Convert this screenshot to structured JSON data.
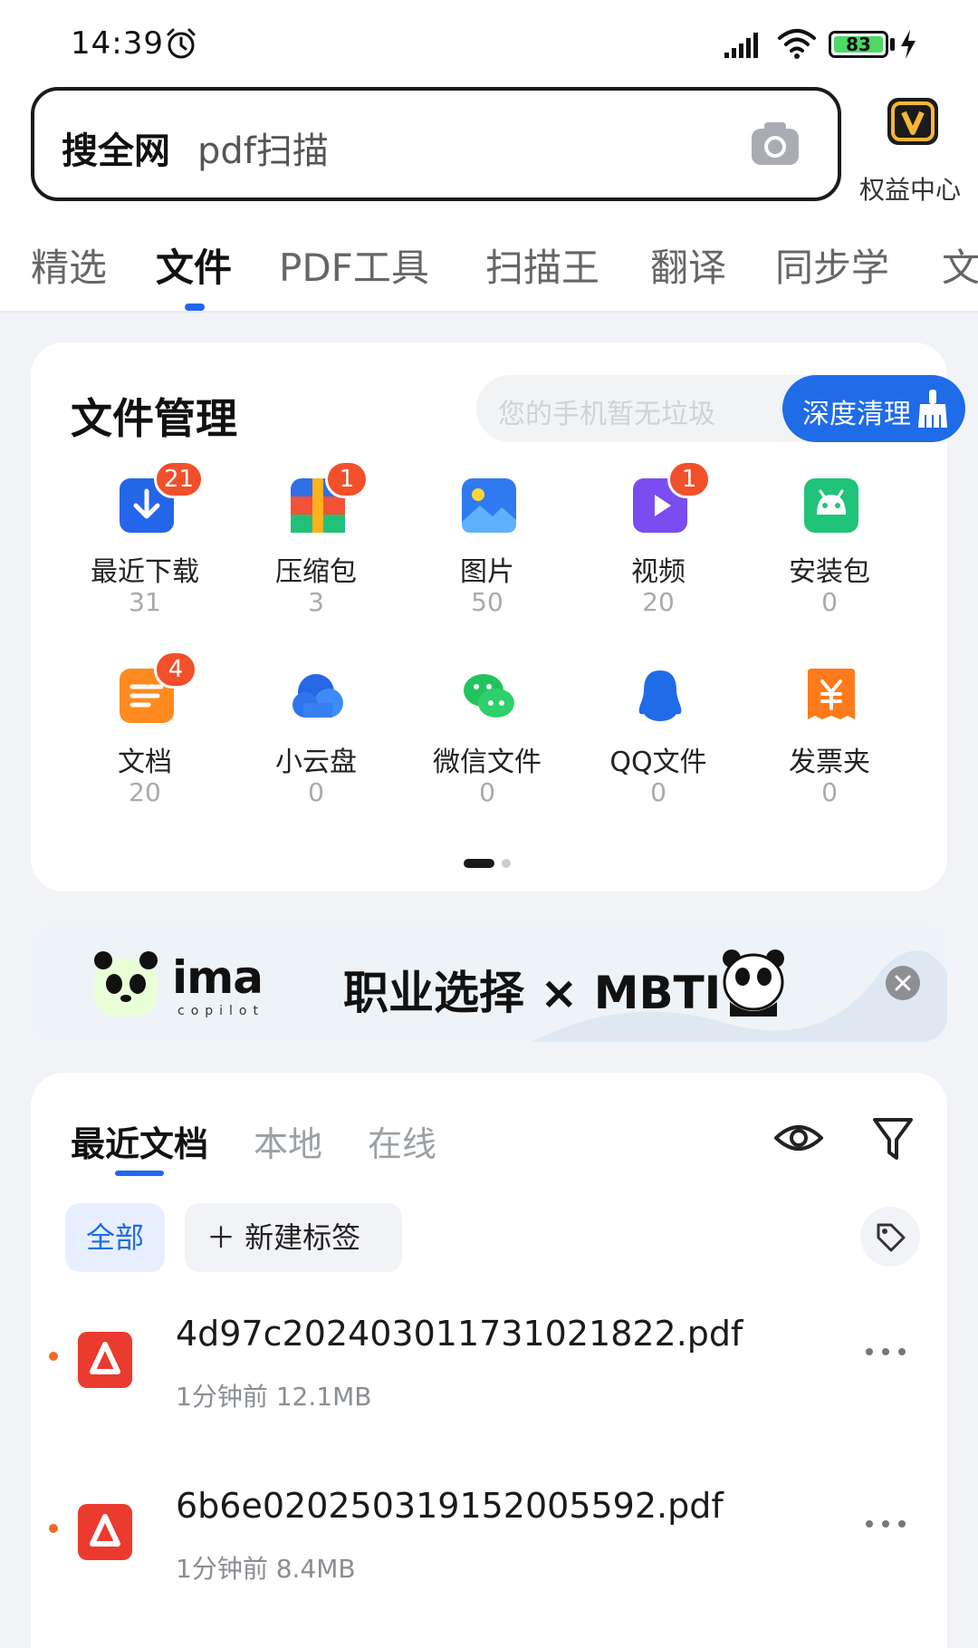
{
  "status_bar": {
    "time": "14:39",
    "battery_level": "83"
  },
  "search": {
    "prefix": "搜全网",
    "query": "pdf扫描"
  },
  "benefit_center": {
    "label": "权益中心"
  },
  "tabs": [
    {
      "label": "精选",
      "active": false
    },
    {
      "label": "文件",
      "active": true
    },
    {
      "label": "PDF工具",
      "active": false
    },
    {
      "label": "扫描王",
      "active": false
    },
    {
      "label": "翻译",
      "active": false
    },
    {
      "label": "同步学",
      "active": false
    },
    {
      "label": "文",
      "active": false
    }
  ],
  "file_management": {
    "title": "文件管理",
    "clean_tip": "您的手机暂无垃圾",
    "clean_button": "深度清理",
    "items": [
      {
        "label": "最近下载",
        "count": "31",
        "badge": "21",
        "icon": "download-icon"
      },
      {
        "label": "压缩包",
        "count": "3",
        "badge": "1",
        "icon": "archive-icon"
      },
      {
        "label": "图片",
        "count": "50",
        "badge": "",
        "icon": "image-icon"
      },
      {
        "label": "视频",
        "count": "20",
        "badge": "1",
        "icon": "video-icon"
      },
      {
        "label": "安装包",
        "count": "0",
        "badge": "",
        "icon": "android-icon"
      },
      {
        "label": "文档",
        "count": "20",
        "badge": "4",
        "icon": "document-icon"
      },
      {
        "label": "小云盘",
        "count": "0",
        "badge": "",
        "icon": "cloud-icon"
      },
      {
        "label": "微信文件",
        "count": "0",
        "badge": "",
        "icon": "wechat-icon"
      },
      {
        "label": "QQ文件",
        "count": "0",
        "badge": "",
        "icon": "qq-icon"
      },
      {
        "label": "发票夹",
        "count": "0",
        "badge": "",
        "icon": "invoice-icon"
      }
    ]
  },
  "banner": {
    "logo_text": "ima",
    "logo_sub": "copilot",
    "headline": "职业选择 × MBTI"
  },
  "recent_docs": {
    "tabs": [
      {
        "label": "最近文档",
        "active": true
      },
      {
        "label": "本地",
        "active": false
      },
      {
        "label": "在线",
        "active": false
      }
    ],
    "chip_all": "全部",
    "chip_new": "＋ 新建标签",
    "files": [
      {
        "name": "4d97c20240301173 1021822.pdf",
        "time": "1分钟前",
        "size": "12.1MB"
      },
      {
        "name": "6b6e020250319152005592.pdf",
        "time": "1分钟前",
        "size": "8.4MB"
      }
    ]
  },
  "colors": {
    "accent": "#1f6be8",
    "badge": "#f2502b",
    "pdf_red": "#ea3b2e",
    "unread_dot": "#f06a2c"
  }
}
